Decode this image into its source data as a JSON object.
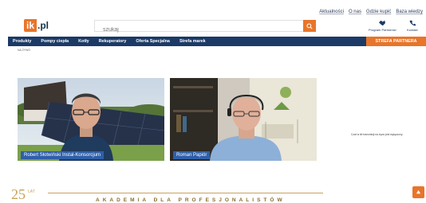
{
  "toplinks": [
    "Aktualności",
    "O nas",
    "Gdzie kupić",
    "Baza wiedzy"
  ],
  "logo": {
    "part1": "ik",
    "part2": ".pl"
  },
  "search": {
    "placeholder": "szukaj"
  },
  "user_links": {
    "partner_program": "Program Partnerski",
    "contact": "Kontakt"
  },
  "nav": {
    "items": [
      "Produkty",
      "Pompy ciepła",
      "Kotły",
      "Rekuperatory",
      "Oferta Specjalna",
      "Strefa marek"
    ],
    "partner_button": "STREFA PARTNERA"
  },
  "breadcrumb_small": "NA ŻYWO",
  "videos": [
    {
      "caption": "Robert Słotwiński Instal-Konsorcjum"
    },
    {
      "caption": "Roman Papiór"
    }
  ],
  "stream_status": "Czat w tle transmisji na żywo jest wyłączony.",
  "bottom": {
    "anniversary": "25",
    "anniversary_sub": "LAT",
    "akademia": "AKADEMIA DLA PROFESJONALISTÓW"
  },
  "colors": {
    "brand_orange": "#e8752a",
    "brand_navy": "#1b3a66",
    "caption_blue": "#2f5fa8"
  }
}
